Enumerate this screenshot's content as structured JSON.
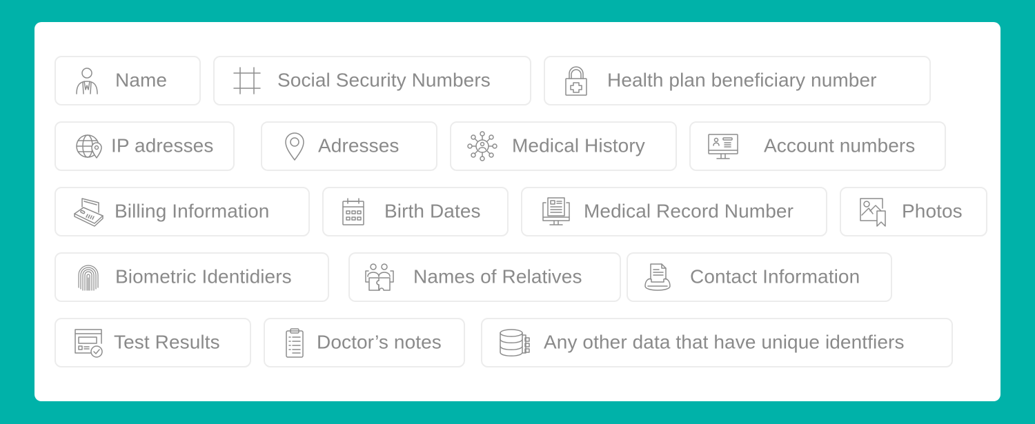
{
  "colors": {
    "background": "#00b2a9",
    "card": "#ffffff",
    "tag_border": "#ececec",
    "text": "#8a8a8a",
    "icon": "#8c8c8c"
  },
  "tags": [
    {
      "label": "Name",
      "icon": "person-suit-icon"
    },
    {
      "label": "Social Security Numbers",
      "icon": "hash-frame-icon"
    },
    {
      "label": "Health plan beneficiary number",
      "icon": "medical-lock-icon"
    },
    {
      "label": "IP adresses",
      "icon": "globe-pin-icon"
    },
    {
      "label": "Adresses",
      "icon": "location-pin-icon"
    },
    {
      "label": "Medical History",
      "icon": "network-person-icon"
    },
    {
      "label": "Account numbers",
      "icon": "monitor-profile-icon"
    },
    {
      "label": "Billing Information",
      "icon": "card-terminal-icon"
    },
    {
      "label": "Birth Dates",
      "icon": "calendar-icon"
    },
    {
      "label": "Medical Record Number",
      "icon": "monitor-document-icon"
    },
    {
      "label": "Photos",
      "icon": "photo-bookmark-icon"
    },
    {
      "label": "Biometric Identidiers",
      "icon": "fingerprint-icon"
    },
    {
      "label": "Names of Relatives",
      "icon": "relatives-puzzle-icon"
    },
    {
      "label": "Contact Information",
      "icon": "phone-document-icon"
    },
    {
      "label": "Test Results",
      "icon": "report-check-icon"
    },
    {
      "label": "Doctor’s notes",
      "icon": "clipboard-icon"
    },
    {
      "label": "Any other data that have unique identfiers",
      "icon": "database-icon"
    }
  ]
}
